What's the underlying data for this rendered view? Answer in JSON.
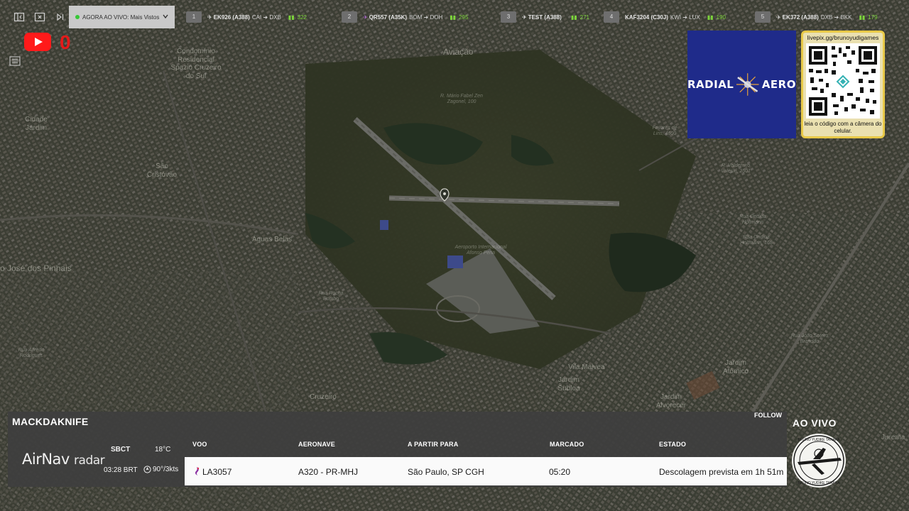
{
  "topbar": {
    "now_live_label": "AGORA AO VIVO: Mais Vistos",
    "flights": [
      {
        "rank": "1",
        "flight": "EK926 (A388)",
        "from": "CAI",
        "to": "DXB",
        "count": "322"
      },
      {
        "rank": "2",
        "flight": "QR557 (A35K)",
        "from": "BOM",
        "to": "DOH",
        "count": "295"
      },
      {
        "rank": "3",
        "flight": "TEST (A388)",
        "from": "",
        "to": "",
        "count": "271"
      },
      {
        "rank": "4",
        "flight": "KAF3204 (C30J)",
        "from": "KWI",
        "to": "LUX",
        "count": "190"
      },
      {
        "rank": "5",
        "flight": "EK372 (A388)",
        "from": "DXB",
        "to": "BKK",
        "count": "179"
      }
    ]
  },
  "youtube": {
    "count": "0",
    "icon": "youtube-icon"
  },
  "sponsor": {
    "word1": "RADIAL",
    "word2": "AERO",
    "bg": "#1f2b8a"
  },
  "qr": {
    "url": "livepix.gg/brunoyudigames",
    "caption": "leia o código com a câmera do celular."
  },
  "map_labels": [
    "Aviação",
    "Condomínio Residencial Spazio Cruzeiro do Sul",
    "Cidade Jardim",
    "São Cristóvão",
    "Águas Belas",
    "o José dos Pinhais",
    "Aeroporto Internacional Afonso Pena",
    "Vila Malvea",
    "Jardim Subloa",
    "Jardim Alvorecer",
    "Jardim Atômico",
    "Cruzeiro",
    "R. Mário Fabel Zen Zagonel, 100",
    "Favares de Lins, 4600",
    "R. Valdemiro Voleski, 2501",
    "Rua Ondina Holtmann",
    "Rua Ondina Holtmann, 168",
    "Rua Alfredo Rodrigues",
    "Rua Rocha Pombo",
    "Rua João Sotero Brandão"
  ],
  "panel": {
    "username": "MACKDAKNIFE",
    "follow": "FOLLOW",
    "brand_main": "AirNav",
    "brand_sub": "radar",
    "airport_code": "SBCT",
    "temperature": "18°C",
    "local_time": "03:28 BRT",
    "wind": "90°/3kts",
    "headers": {
      "flight": "VOO",
      "aircraft": "AERONAVE",
      "from_to": "A PARTIR PARA",
      "scheduled": "MARCADO",
      "status": "ESTADO"
    },
    "row": {
      "flight": "LA3057",
      "aircraft": "A320 - PR-MHJ",
      "from_to": "São Paulo, SP CGH",
      "scheduled": "05:20",
      "status": "Descolagem prevista em 1h 51m"
    }
  },
  "live": {
    "label": "AO VIVO",
    "badge_text_top": "BRUNO YUDIKE TANAKA",
    "badge_text_bottom": "BRUNO YUDIKE TANAKA"
  },
  "extra_label": "Jurema",
  "colors": {
    "accent_green": "#7cd33c",
    "live_red": "#e41a1a",
    "qr_border": "#e8c948"
  }
}
